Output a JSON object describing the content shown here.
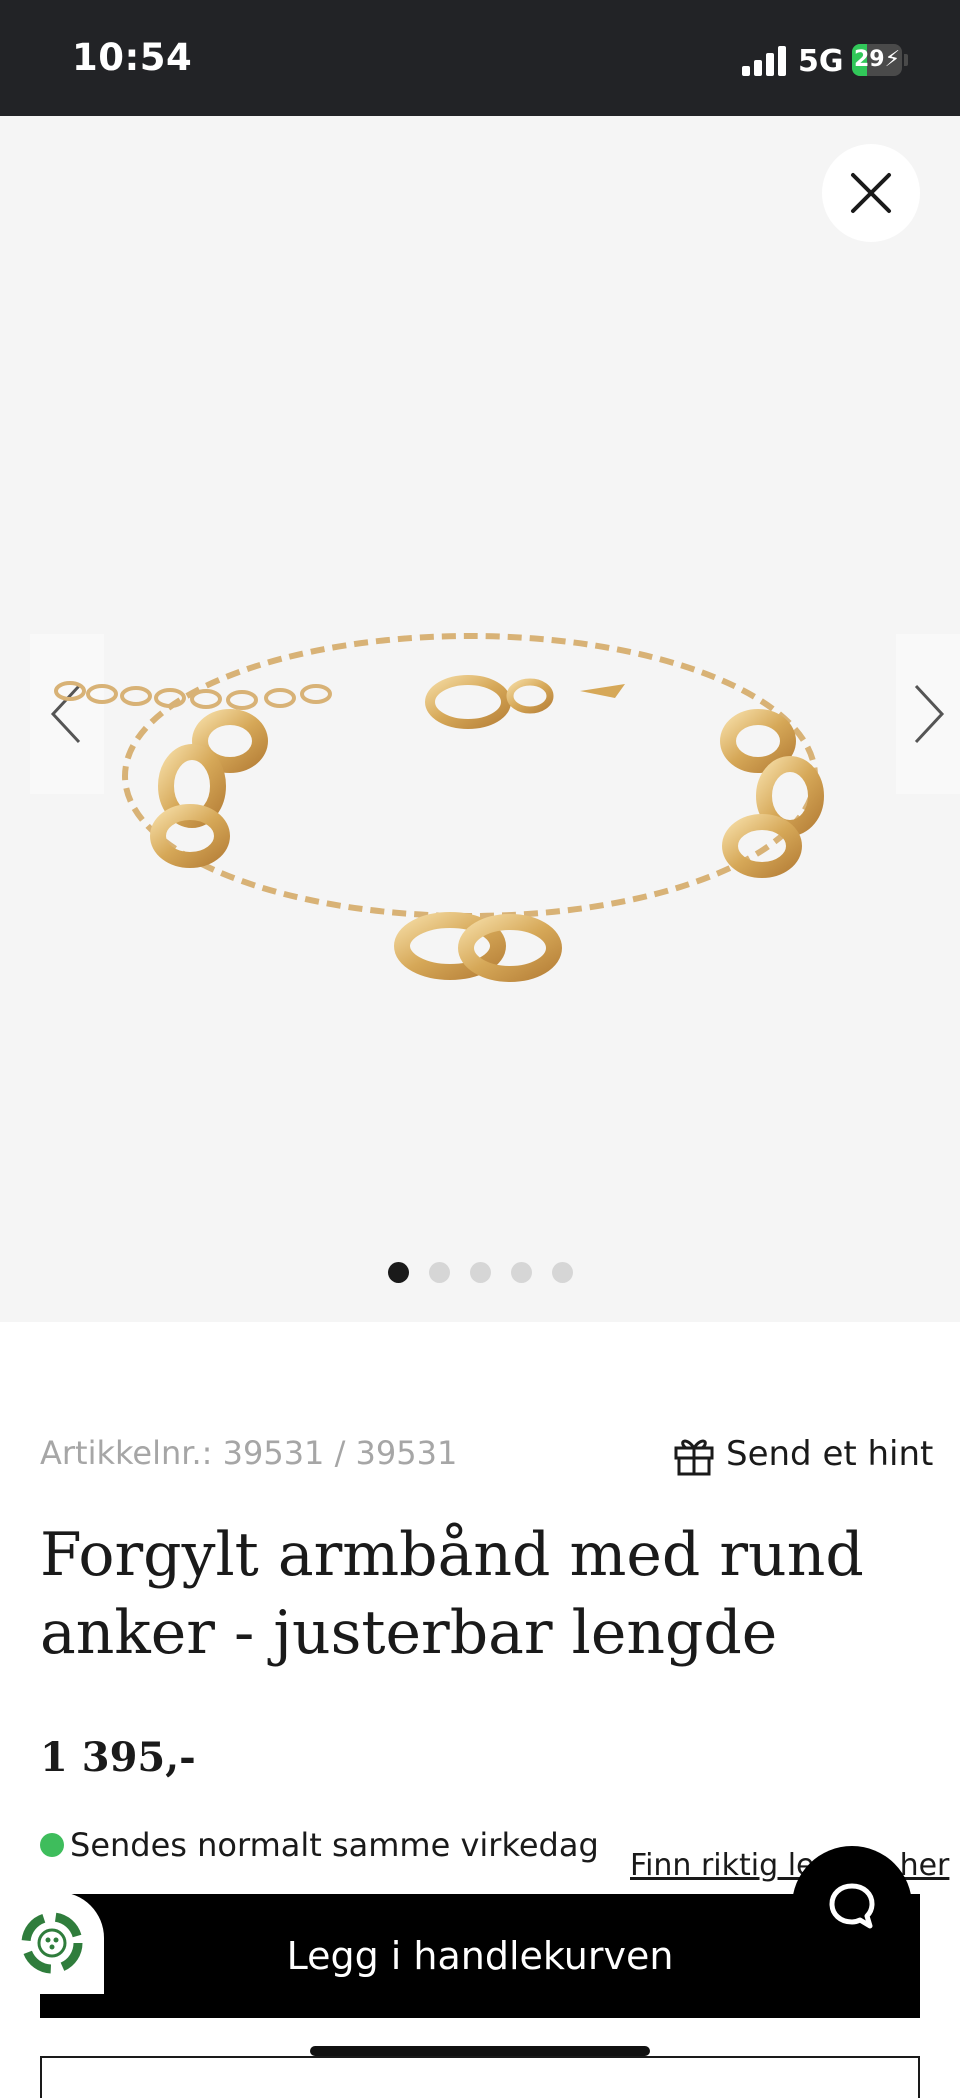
{
  "status_bar": {
    "time": "10:54",
    "network": "5G",
    "battery_text": "29",
    "battery_level": 0.29,
    "battery_color": "#31c759"
  },
  "gallery": {
    "close_icon": "close-icon",
    "prev_icon": "chevron-left-icon",
    "next_icon": "chevron-right-icon",
    "slide_count": 5,
    "active_slide": 1
  },
  "product": {
    "article_number": "Artikkelnr.: 39531 / 39531",
    "hint_label": "Send et hint",
    "hint_icon": "gift-icon",
    "title": "Forgylt armbånd med rund anker - justerbar lengde",
    "price": "1 395,-",
    "availability": "Sendes normalt samme virkedag",
    "availability_color": "#3ebd5c",
    "size_link": "Finn riktig lengde her"
  },
  "actions": {
    "add_to_cart": "Legg i handlekurven",
    "chat_icon": "chat-bubble-icon",
    "eco_icon": "recycle-badge-icon"
  }
}
